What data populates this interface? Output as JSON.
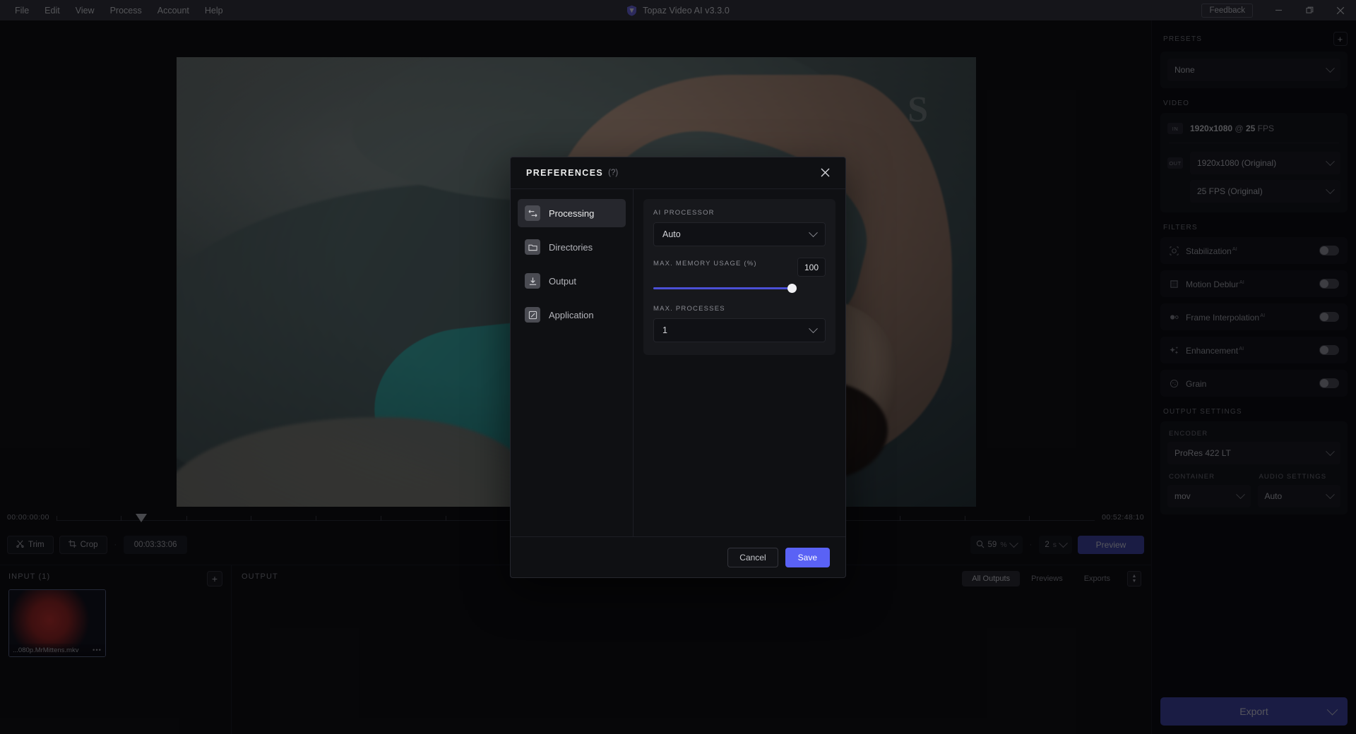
{
  "titlebar": {
    "menus": [
      "File",
      "Edit",
      "View",
      "Process",
      "Account",
      "Help"
    ],
    "app_title": "Topaz Video AI  v3.3.0",
    "logo_icon": "topaz-shield-icon",
    "feedback_label": "Feedback",
    "minimize_icon": "minimize-icon",
    "maximize_icon": "maximize-icon",
    "close_icon": "close-icon"
  },
  "preview": {
    "watermark": "S"
  },
  "timeline": {
    "start_timecode": "00:00:00:00",
    "end_timecode": "00:52:48:10",
    "trim_label": "Trim",
    "crop_label": "Crop",
    "separator": "·",
    "duration": "00:03:33:06",
    "zoom_icon": "magnifier-icon",
    "zoom_value": "59",
    "zoom_unit": "%",
    "seconds_value": "2",
    "seconds_unit": "s",
    "preview_label": "Preview"
  },
  "io": {
    "input_title": "INPUT (1)",
    "add_icon": "plus-icon",
    "input_file": "...080p.MrMittens.mkv",
    "more_icon": "ellipsis-icon",
    "output_title": "OUTPUT",
    "output_tabs": [
      "All Outputs",
      "Previews",
      "Exports"
    ],
    "output_active_tab": "All Outputs",
    "sort_icon": "sort-icon"
  },
  "sidebar": {
    "presets": {
      "label": "PRESETS",
      "add_icon": "plus-icon",
      "selected": "None"
    },
    "video": {
      "label": "VIDEO",
      "in_badge": "IN",
      "in_resolution": "1920x1080",
      "in_sep": "@",
      "in_fps": "25",
      "in_fps_unit": "FPS",
      "out_badge": "OUT",
      "out_resolution": "1920x1080 (Original)",
      "out_fps": "25 FPS (Original)"
    },
    "filters": {
      "label": "FILTERS",
      "items": [
        {
          "name": "Stabilization",
          "ai": "AI",
          "icon": "stabilization-icon",
          "enabled": false
        },
        {
          "name": "Motion Deblur",
          "ai": "AI",
          "icon": "motion-deblur-icon",
          "enabled": false
        },
        {
          "name": "Frame Interpolation",
          "ai": "AI",
          "icon": "frame-interpolation-icon",
          "enabled": false
        },
        {
          "name": "Enhancement",
          "ai": "AI",
          "icon": "enhancement-icon",
          "enabled": false
        },
        {
          "name": "Grain",
          "ai": "",
          "icon": "grain-icon",
          "enabled": false
        }
      ]
    },
    "output_settings": {
      "label": "OUTPUT SETTINGS",
      "encoder_label": "ENCODER",
      "encoder_value": "ProRes 422 LT",
      "container_label": "CONTAINER",
      "container_value": "mov",
      "audio_label": "AUDIO SETTINGS",
      "audio_value": "Auto"
    },
    "export_label": "Export"
  },
  "modal": {
    "title": "PREFERENCES",
    "help": "(?)",
    "close_icon": "close-icon",
    "nav": [
      {
        "label": "Processing",
        "icon": "processing-icon",
        "active": true
      },
      {
        "label": "Directories",
        "icon": "folder-icon",
        "active": false
      },
      {
        "label": "Output",
        "icon": "download-icon",
        "active": false
      },
      {
        "label": "Application",
        "icon": "app-edit-icon",
        "active": false
      }
    ],
    "ai_processor_label": "AI PROCESSOR",
    "ai_processor_value": "Auto",
    "memory_label": "MAX. MEMORY USAGE (%)",
    "memory_value": "100",
    "memory_percent": 100,
    "processes_label": "MAX. PROCESSES",
    "processes_value": "1",
    "cancel_label": "Cancel",
    "save_label": "Save"
  },
  "colors": {
    "accent": "#5a62f5",
    "export": "#3f44a8",
    "titlebar": "#32343c",
    "panel": "#121317"
  }
}
